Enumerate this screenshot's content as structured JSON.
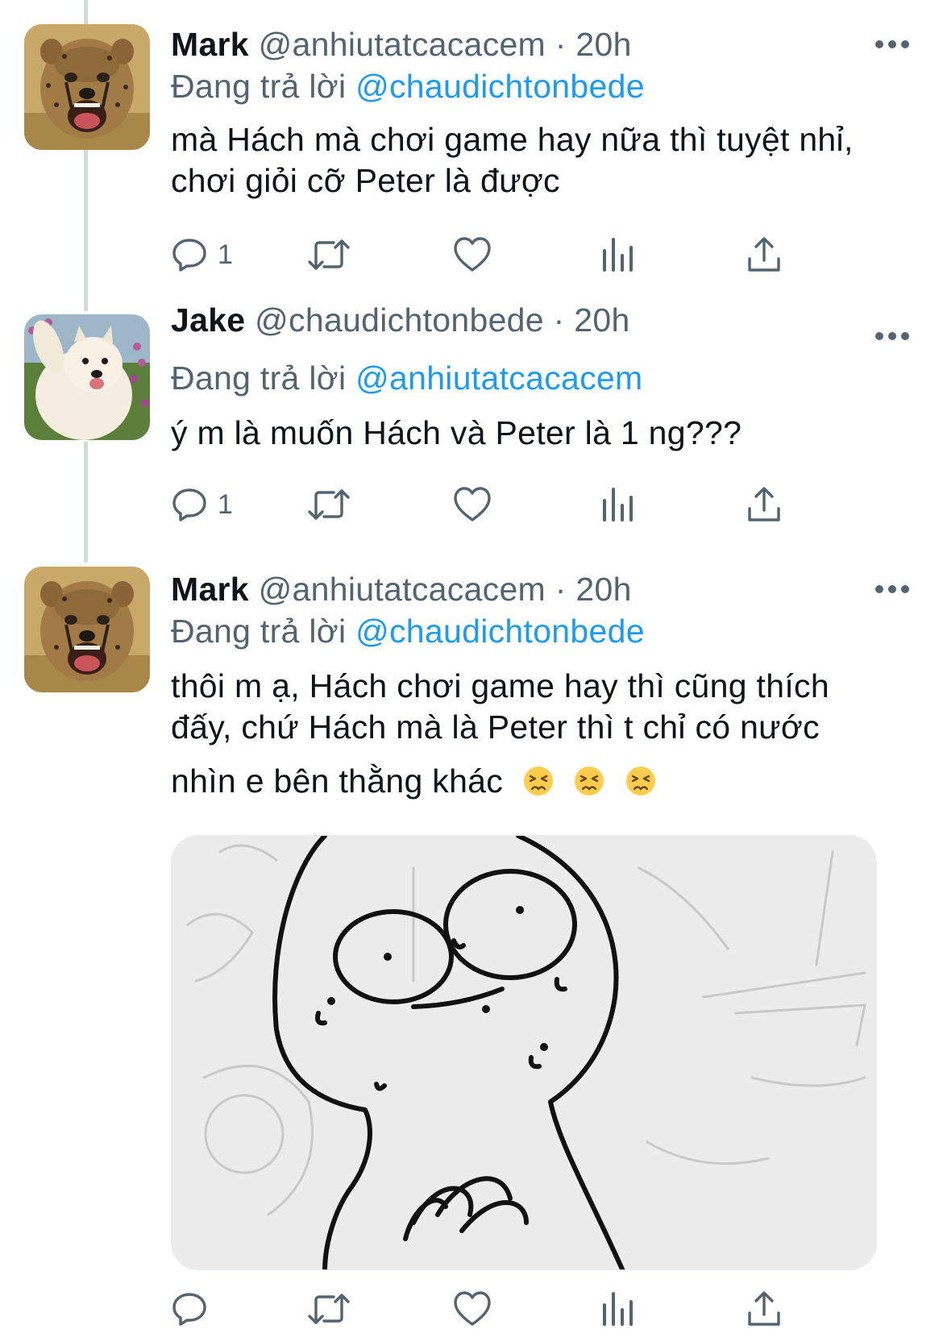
{
  "tweets": [
    {
      "name": "Mark",
      "handle": "@anhiutatcacacem",
      "separator": "·",
      "time": "20h",
      "reply_prefix": "Đang trả lời",
      "reply_to": "@chaudichtonbede",
      "text_lines": [
        "mà Hách mà chơi game hay nữa thì tuyệt nhỉ,",
        "chơi giỏi cỡ Peter là được"
      ],
      "reply_count": "1",
      "avatar_icon": "cheetah-cub-avatar"
    },
    {
      "name": "Jake",
      "handle": "@chaudichtonbede",
      "separator": "·",
      "time": "20h",
      "reply_prefix": "Đang trả lời",
      "reply_to": "@anhiutatcacacem",
      "text_lines": [
        "ý m là muốn Hách và Peter là 1 ng???"
      ],
      "reply_count": "1",
      "avatar_icon": "samoyed-dog-avatar"
    },
    {
      "name": "Mark",
      "handle": "@anhiutatcacacem",
      "separator": "·",
      "time": "20h",
      "reply_prefix": "Đang trả lời",
      "reply_to": "@chaudichtonbede",
      "text_lines": [
        "thôi m ạ, Hách chơi game hay thì cũng thích",
        "đấy, chứ Hách mà là Peter thì t chỉ có nước",
        "nhìn e bên thằng khác"
      ],
      "emoji": [
        "😣",
        "😣",
        "😣"
      ],
      "reply_count": "",
      "avatar_icon": "cheetah-cub-avatar",
      "media_icon": "sketch-cartoon-image"
    }
  ],
  "colors": {
    "text": "#0f1419",
    "secondary": "#536471",
    "link": "#1d9bf0",
    "thread_line": "#cfd9de"
  }
}
